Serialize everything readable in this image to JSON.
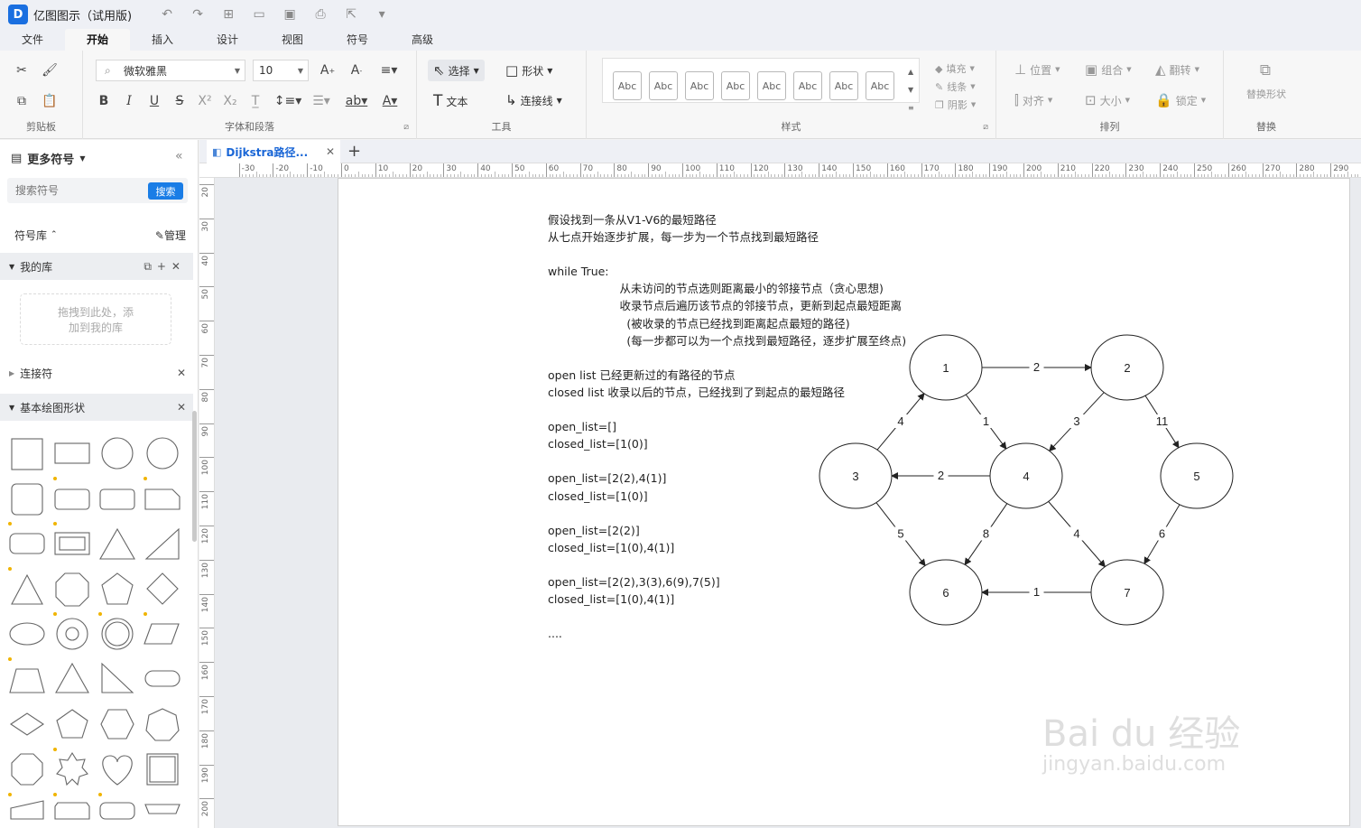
{
  "app": {
    "title": "亿图图示（试用版)"
  },
  "menu": {
    "tabs": [
      "文件",
      "开始",
      "插入",
      "设计",
      "视图",
      "符号",
      "高级"
    ],
    "active": "开始"
  },
  "ribbon": {
    "clipboard_label": "剪贴板",
    "font_name": "微软雅黑",
    "font_size": "10",
    "font_group_label": "字体和段落",
    "select_label": "选择",
    "shape_label": "形状",
    "text_label": "文本",
    "connector_label": "连接线",
    "tools_label": "工具",
    "style_sample": "Abc",
    "fill_label": "填充",
    "line_label": "线条",
    "shadow_label": "阴影",
    "style_label": "样式",
    "position_label": "位置",
    "group_label": "组合",
    "rotate_label": "翻转",
    "align_label": "对齐",
    "size_label": "大小",
    "lock_label": "锁定",
    "arrange_label": "排列",
    "replace_shape_label": "替换形状",
    "replace_label": "替换"
  },
  "left_panel": {
    "header": "更多符号",
    "search_placeholder": "搜索符号",
    "search_button": "搜索",
    "library_label": "符号库",
    "manage_label": "管理",
    "my_library": "我的库",
    "dropzone_text_1": "拖拽到此处，添",
    "dropzone_text_2": "加到我的库",
    "connectors": "连接符",
    "basic_shapes": "基本绘图形状"
  },
  "doc_tab": {
    "title": "Dijkstra路径..."
  },
  "ruler": {
    "h_ticks": [
      "-30",
      "-20",
      "-10",
      "0",
      "10",
      "20",
      "30",
      "40",
      "50",
      "60",
      "70",
      "80",
      "90",
      "100",
      "110",
      "120",
      "130",
      "140",
      "150",
      "160",
      "170",
      "180",
      "190",
      "200",
      "210",
      "220",
      "230",
      "240",
      "250",
      "260",
      "270",
      "280",
      "290"
    ],
    "v_ticks": [
      "20",
      "30",
      "40",
      "50",
      "60",
      "70",
      "80",
      "90",
      "100",
      "110",
      "120",
      "130",
      "140",
      "150",
      "160",
      "170",
      "180",
      "190",
      "200"
    ]
  },
  "text_lines": [
    "假设找到一条从V1-V6的最短路径",
    "从七点开始逐步扩展，每一步为一个节点找到最短路径",
    "",
    "while True:",
    "                    从未访问的节点选则距离最小的邻接节点（贪心思想)",
    "                    收录节点后遍历该节点的邻接节点，更新到起点最短距离",
    "                      (被收录的节点已经找到距离起点最短的路径)",
    "                      (每一步都可以为一个点找到最短路径，逐步扩展至终点)",
    "",
    "open list 已经更新过的有路径的节点",
    "closed list 收录以后的节点，已经找到了到起点的最短路径",
    "",
    "open_list=[]",
    "closed_list=[1(0)]",
    "",
    "open_list=[2(2),4(1)]",
    "closed_list=[1(0)]",
    "",
    "open_list=[2(2)]",
    "closed_list=[1(0),4(1)]",
    "",
    "open_list=[2(2),3(3),6(9),7(5)]",
    "closed_list=[1(0),4(1)]",
    "",
    "...."
  ],
  "graph": {
    "nodes": [
      "1",
      "2",
      "3",
      "4",
      "5",
      "6",
      "7"
    ],
    "edges": [
      {
        "from": "1",
        "to": "2",
        "weight": "2"
      },
      {
        "from": "1",
        "to": "4",
        "weight": "1"
      },
      {
        "from": "2",
        "to": "4",
        "weight": "3"
      },
      {
        "from": "2",
        "to": "5",
        "weight": "11"
      },
      {
        "from": "3",
        "to": "1",
        "weight": "4"
      },
      {
        "from": "4",
        "to": "3",
        "weight": "2"
      },
      {
        "from": "3",
        "to": "6",
        "weight": "5"
      },
      {
        "from": "4",
        "to": "6",
        "weight": "8"
      },
      {
        "from": "4",
        "to": "7",
        "weight": "4"
      },
      {
        "from": "5",
        "to": "7",
        "weight": "6"
      },
      {
        "from": "7",
        "to": "6",
        "weight": "1"
      }
    ]
  },
  "watermark": {
    "main": "Bai du 经验",
    "sub": "jingyan.baidu.com"
  }
}
